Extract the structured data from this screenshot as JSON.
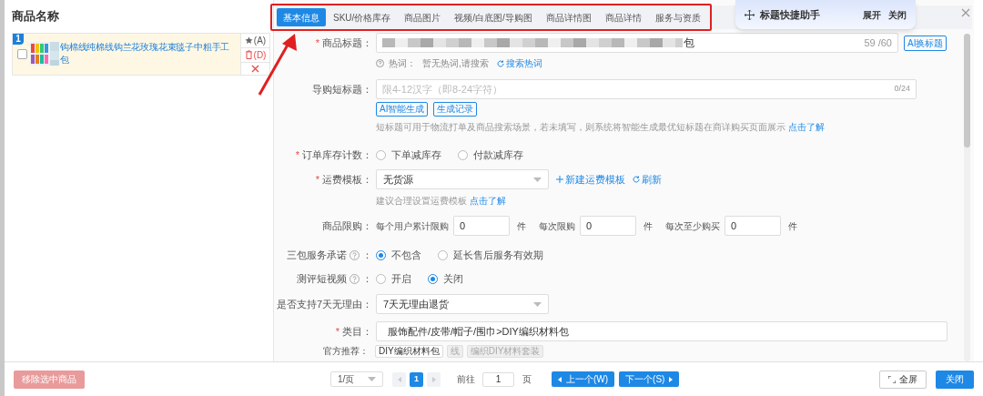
{
  "left_panel": {
    "header": "商品名称",
    "items": [
      {
        "index": "1",
        "checked": false,
        "title_line1": "钩棉线纯棉线钩兰花玫瑰花束毯子中粗手工",
        "title_line2": "包",
        "actions": [
          {
            "kind": "star",
            "label": "(A)"
          },
          {
            "kind": "delete",
            "label": "(D)"
          },
          {
            "kind": "close"
          }
        ]
      }
    ]
  },
  "tabs": [
    {
      "label": "基本信息",
      "selected": true
    },
    {
      "label": "SKU/价格库存",
      "selected": false
    },
    {
      "label": "商品图片",
      "selected": false
    },
    {
      "label": "视频/白底图/导购图",
      "selected": false
    },
    {
      "label": "商品详情图",
      "selected": false
    },
    {
      "label": "商品详情",
      "selected": false
    },
    {
      "label": "服务与资质",
      "selected": false
    }
  ],
  "helper": {
    "title": "标题快捷助手",
    "actions": [
      "展开",
      "关闭"
    ]
  },
  "fields": [
    {
      "kind": "title",
      "mark": "*",
      "label": "商品标题：",
      "value_end": "包",
      "counter": "59 /60",
      "button": "AI换标题",
      "hint_label": "热词：",
      "hint_text": "暂无热词,请搜索",
      "hint_link": "搜索热词"
    },
    {
      "kind": "short_title",
      "label": "导购短标题：",
      "placeholder": "限4-12汉字（即8-24字符）",
      "counter": "0/24",
      "buttons": [
        "AI智能生成",
        "生成记录"
      ],
      "help": "短标题可用于物流打单及商品搜索场景，若未填写，则系统将智能生成最优短标题在商详购买页面展示",
      "help_link": "点击了解"
    },
    {
      "kind": "radio",
      "mark": "*",
      "label": "订单库存计数：",
      "options": [
        {
          "label": "下单减库存",
          "selected": false
        },
        {
          "label": "付款减库存",
          "selected": false
        }
      ]
    },
    {
      "kind": "select",
      "mark": "*",
      "label": "运费模板：",
      "value": "无货源",
      "links": [
        "新建运费模板",
        "刷新"
      ],
      "hint": "建议合理设置运费模板",
      "hint_link": "点击了解"
    },
    {
      "kind": "limits",
      "label": "商品限购：",
      "groups": [
        {
          "label": "每个用户累计限购",
          "value": "0",
          "unit": "件"
        },
        {
          "label": "每次限购",
          "value": "0",
          "unit": "件"
        },
        {
          "label": "每次至少购买",
          "value": "0",
          "unit": "件"
        }
      ]
    },
    {
      "kind": "radio",
      "label": "三包服务承诺",
      "info": true,
      "colon": "：",
      "options": [
        {
          "label": "不包含",
          "selected": true
        },
        {
          "label": "延长售后服务有效期",
          "selected": false
        }
      ]
    },
    {
      "kind": "radio",
      "label": "测评短视频",
      "info": true,
      "colon": "：",
      "options": [
        {
          "label": "开启",
          "selected": false
        },
        {
          "label": "关闭",
          "selected": true
        }
      ]
    },
    {
      "kind": "select",
      "label": "是否支持7天无理由：",
      "value": "7天无理由退货"
    },
    {
      "kind": "category",
      "mark": "*",
      "label": "类目：",
      "value": "服饰配件/皮带/帽子/围巾>DIY编织材料包",
      "rec_label": "官方推荐：",
      "recommendations": [
        {
          "label": "DIY编织材料包",
          "disabled": false
        },
        {
          "label": "线",
          "disabled": true
        },
        {
          "label": "编织DIY材料套装",
          "disabled": true
        }
      ]
    }
  ],
  "footer": {
    "remove_button": "移除选中商品",
    "page_size": "1/页",
    "pages": [
      {
        "label": "1",
        "selected": true
      }
    ],
    "goto_label": "前往",
    "goto_value": "1",
    "page_unit": "页",
    "prev_button": "上一个(W)",
    "next_button": "下一个(S)",
    "fullscreen_button": "全屏",
    "close_button": "关闭"
  }
}
